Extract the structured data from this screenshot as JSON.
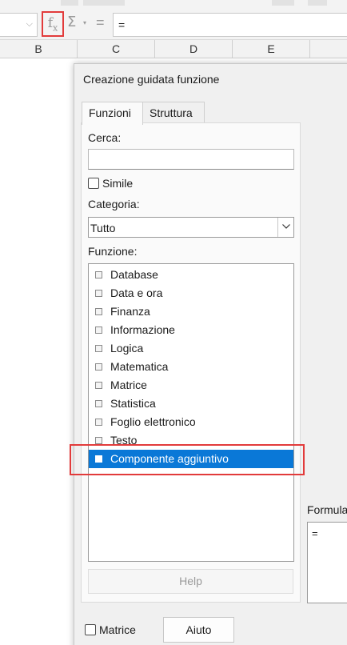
{
  "formula_bar": {
    "fx_label": "f",
    "fx_sub": "x",
    "sum_symbol": "Σ",
    "sum_dropdown": "▾",
    "equals_symbol": "=",
    "formula_value": "="
  },
  "columns": [
    "B",
    "C",
    "D",
    "E"
  ],
  "dialog": {
    "title": "Creazione guidata funzione",
    "tabs": [
      "Funzioni",
      "Struttura"
    ],
    "search_label": "Cerca:",
    "search_value": "",
    "similar_label": "Simile",
    "category_label": "Categoria:",
    "category_value": "Tutto",
    "function_label": "Funzione:",
    "functions": [
      "Database",
      "Data e ora",
      "Finanza",
      "Informazione",
      "Logica",
      "Matematica",
      "Matrice",
      "Statistica",
      "Foglio elettronico",
      "Testo",
      "Componente aggiuntivo"
    ],
    "selected_function_index": 10,
    "help_label": "Help",
    "formula_label": "Formula",
    "formula_value": "=",
    "array_label": "Matrice",
    "aiuto_label": "Aiuto"
  },
  "colors": {
    "selection": "#0a78d7",
    "highlight_border": "#e23b3b"
  }
}
